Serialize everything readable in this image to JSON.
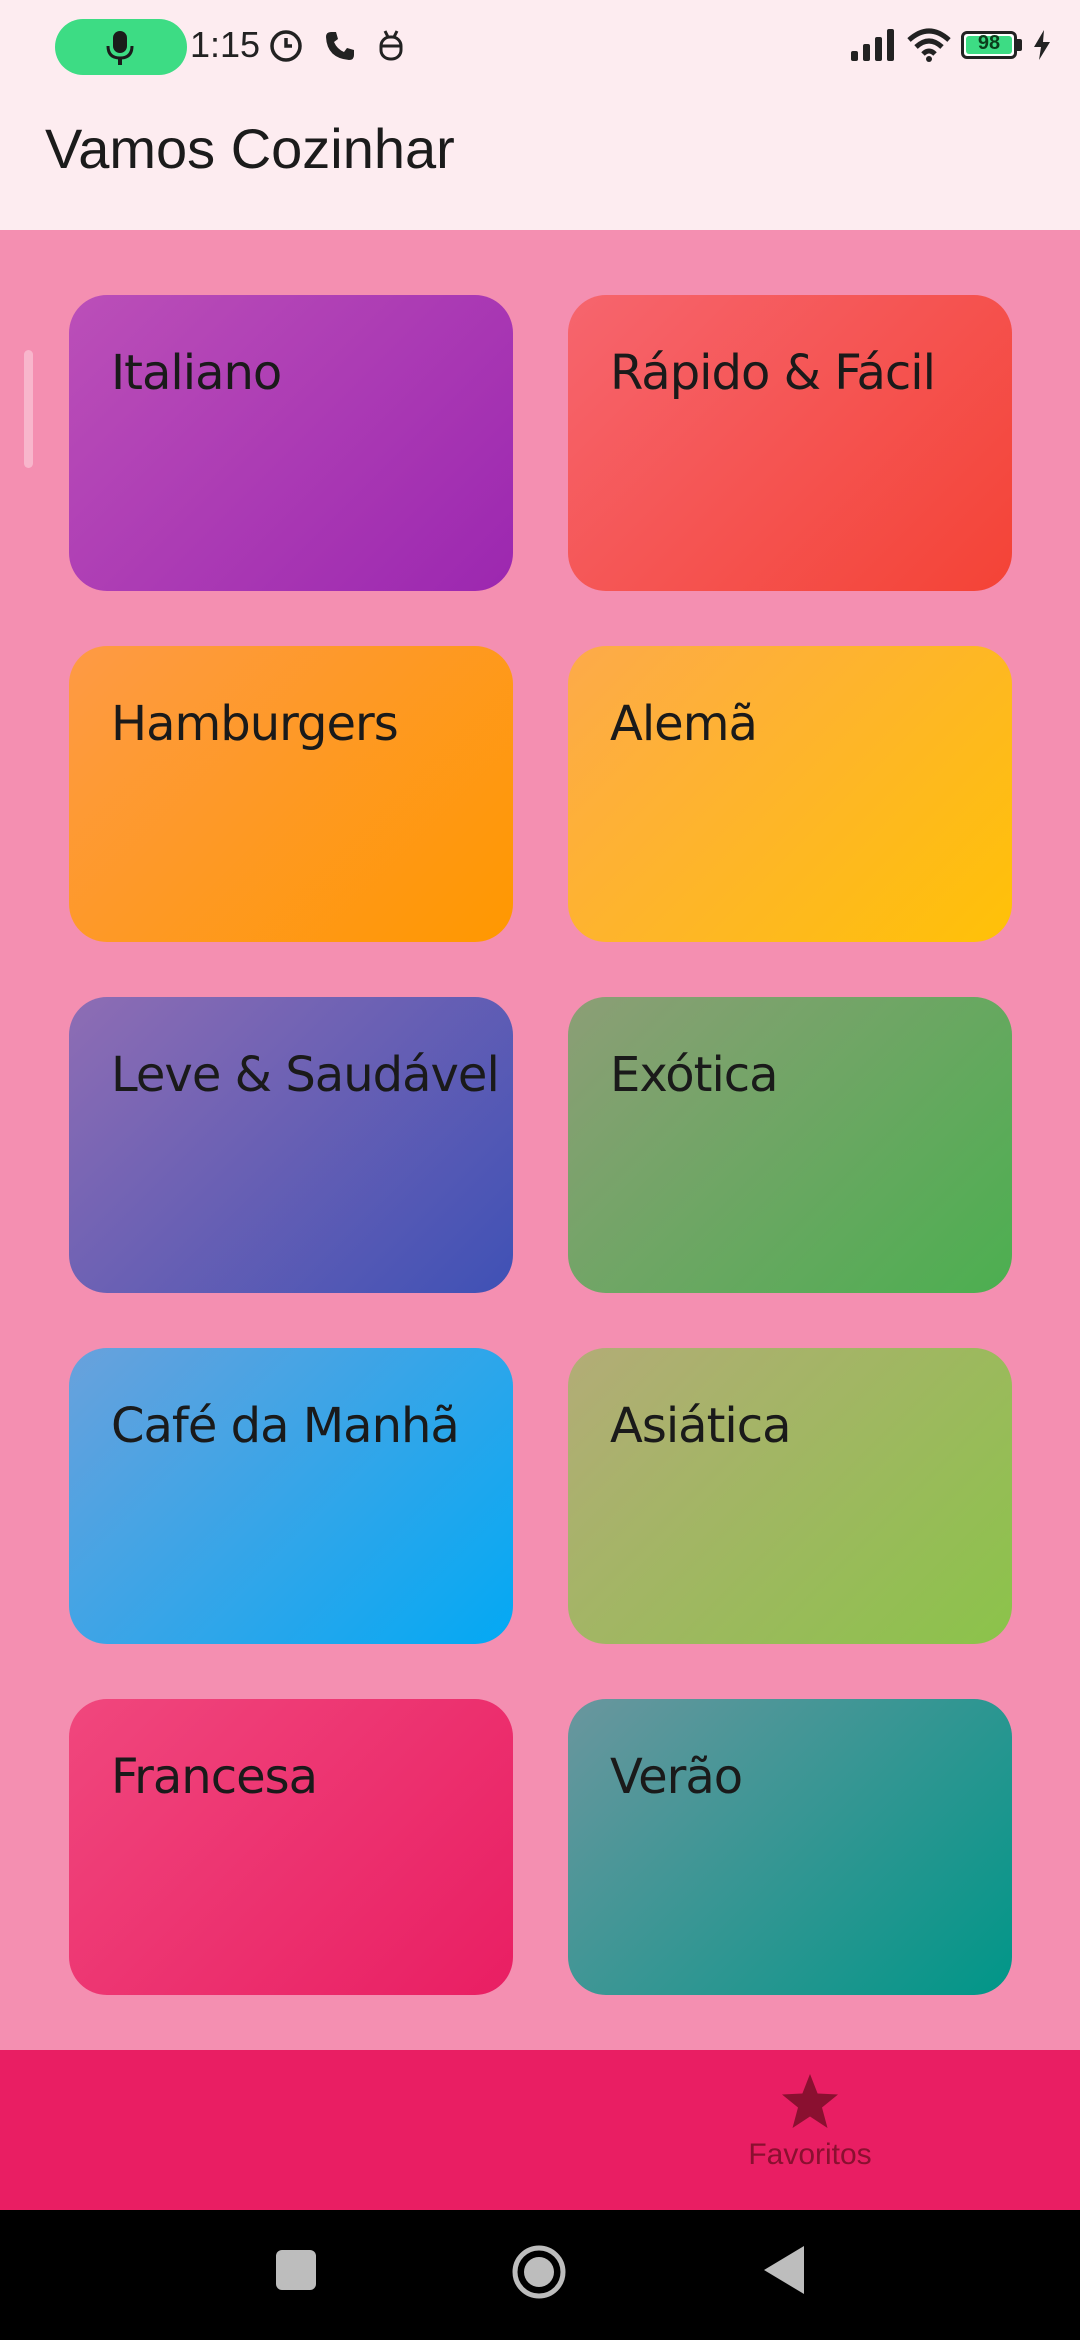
{
  "status_bar": {
    "time": "1:15",
    "battery_level": "98",
    "icons": [
      "mic-icon",
      "alarm-icon",
      "phone-icon",
      "android-debug-icon",
      "signal-icon",
      "wifi-icon",
      "battery-icon",
      "charging-icon"
    ],
    "accent_color": "#3ddc84"
  },
  "app_bar": {
    "title": "Vamos Cozinhar"
  },
  "categories": [
    {
      "label": "Italiano",
      "colors": [
        "#bb4fb8",
        "#9c27b0"
      ]
    },
    {
      "label": "Rápido & Fácil",
      "colors": [
        "#f6656e",
        "#f44336"
      ]
    },
    {
      "label": "Hamburgers",
      "colors": [
        "#fe9a45",
        "#ff9800"
      ]
    },
    {
      "label": "Alemã",
      "colors": [
        "#fdaa4a",
        "#ffc107"
      ]
    },
    {
      "label": "Leve & Saudável",
      "colors": [
        "#8e6db4",
        "#3f51b5"
      ]
    },
    {
      "label": "Exótica",
      "colors": [
        "#8c9e76",
        "#4caf50"
      ]
    },
    {
      "label": "Café da Manhã",
      "colors": [
        "#69a1dc",
        "#03a9f4"
      ]
    },
    {
      "label": "Asiática",
      "colors": [
        "#b3ac77",
        "#8bc34a"
      ]
    },
    {
      "label": "Francesa",
      "colors": [
        "#f0477d",
        "#e91e63"
      ]
    },
    {
      "label": "Verão",
      "colors": [
        "#6a969e",
        "#009688"
      ]
    }
  ],
  "bottom_nav": {
    "favorites_label": "Favoritos",
    "favorites_icon": "star-icon",
    "background": "#e91e63"
  },
  "system_nav": {
    "icons": [
      "recents-icon",
      "home-icon",
      "back-icon"
    ]
  }
}
